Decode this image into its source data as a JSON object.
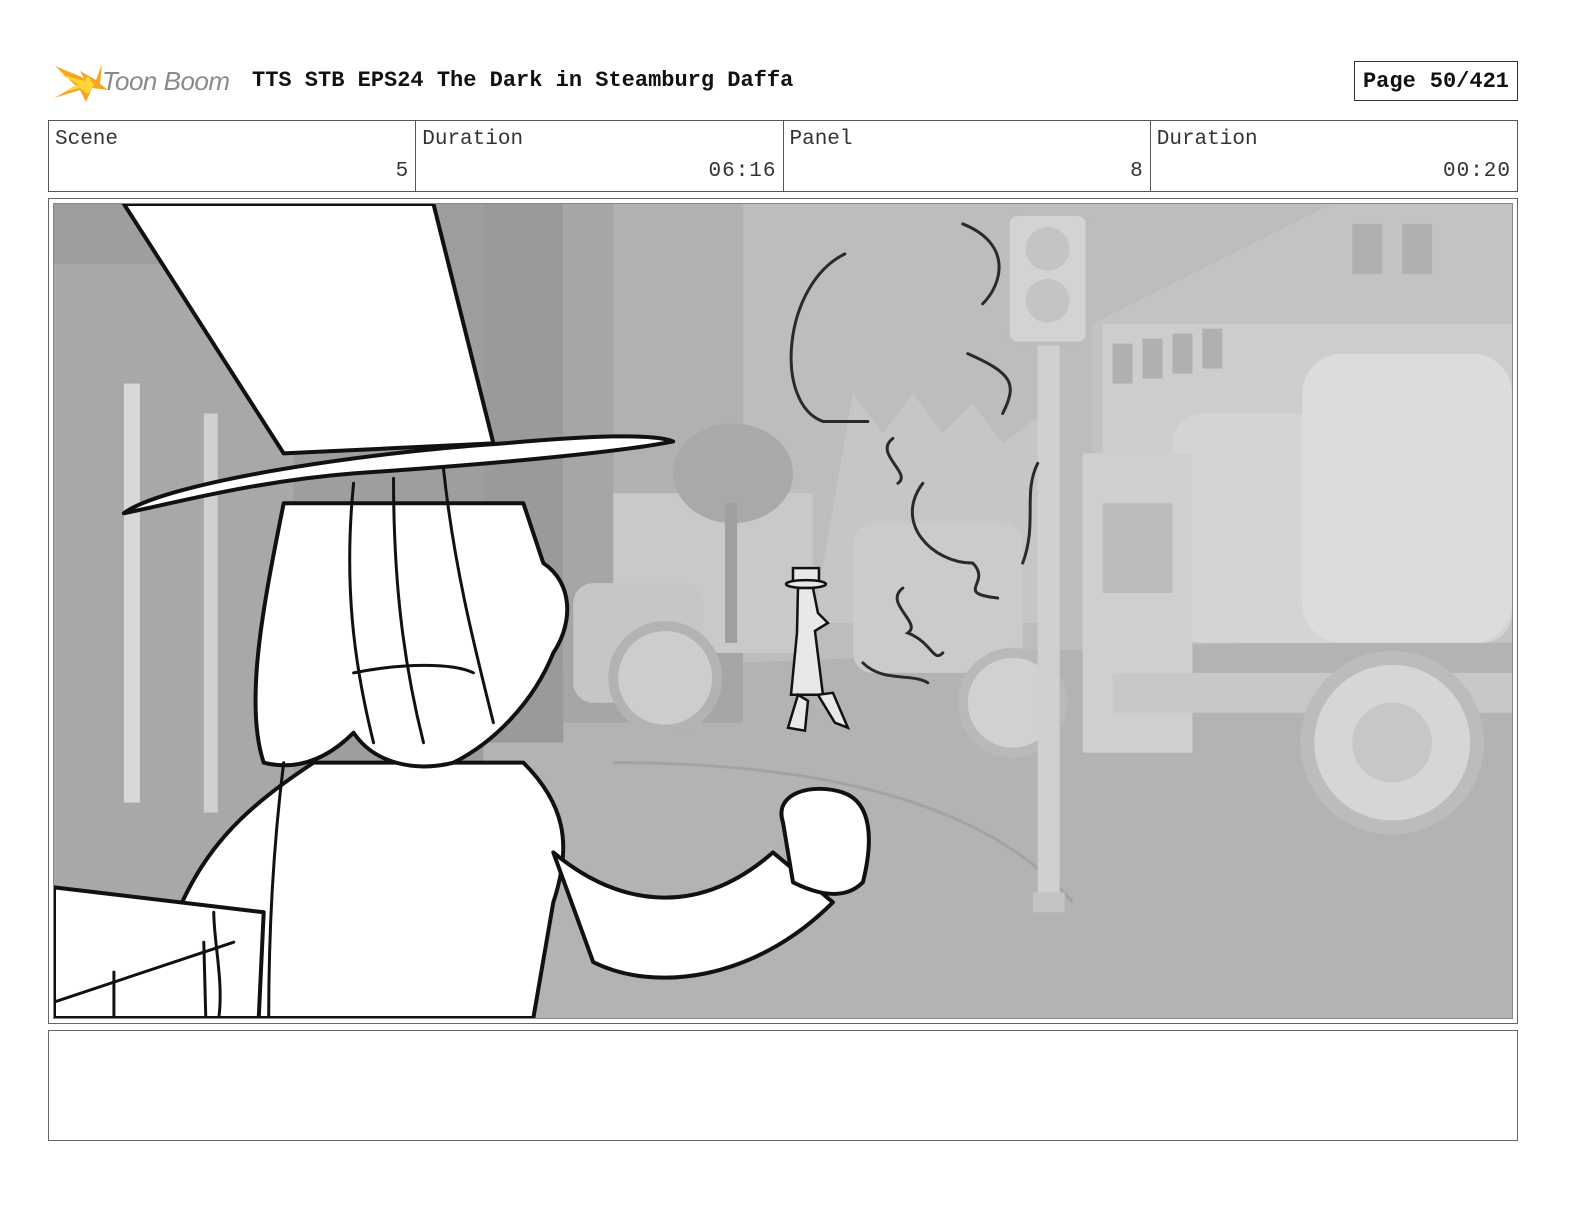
{
  "header": {
    "logo_text": "Toon Boom",
    "title": "TTS STB EPS24 The Dark in Steamburg Daffa",
    "page_label": "Page",
    "page_value": "50/421"
  },
  "info": [
    {
      "label": "Scene",
      "value": "5"
    },
    {
      "label": "Duration",
      "value": "06:16"
    },
    {
      "label": "Panel",
      "value": "8"
    },
    {
      "label": "Duration",
      "value": "00:20"
    }
  ],
  "colors": {
    "logo_orange": "#f5a623",
    "logo_yellow": "#ffd22e",
    "line": "#111111"
  },
  "notes": ""
}
